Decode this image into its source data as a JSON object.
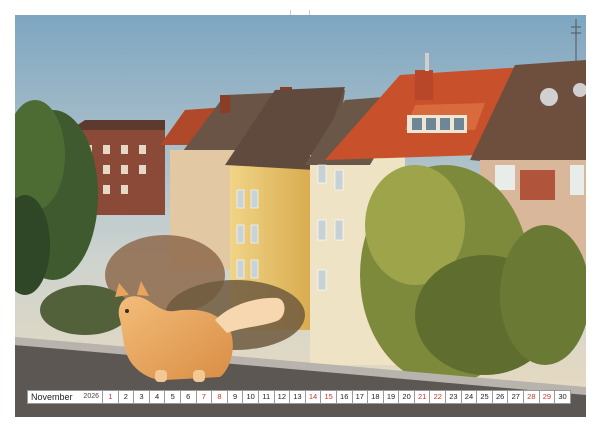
{
  "calendar": {
    "month": "November",
    "year": "2026",
    "days": [
      {
        "n": "1",
        "we": true
      },
      {
        "n": "2",
        "we": false
      },
      {
        "n": "3",
        "we": false
      },
      {
        "n": "4",
        "we": false
      },
      {
        "n": "5",
        "we": false
      },
      {
        "n": "6",
        "we": false
      },
      {
        "n": "7",
        "we": true
      },
      {
        "n": "8",
        "we": true
      },
      {
        "n": "9",
        "we": false
      },
      {
        "n": "10",
        "we": false
      },
      {
        "n": "11",
        "we": false
      },
      {
        "n": "12",
        "we": false
      },
      {
        "n": "13",
        "we": false
      },
      {
        "n": "14",
        "we": true
      },
      {
        "n": "15",
        "we": true
      },
      {
        "n": "16",
        "we": false
      },
      {
        "n": "17",
        "we": false
      },
      {
        "n": "18",
        "we": false
      },
      {
        "n": "19",
        "we": false
      },
      {
        "n": "20",
        "we": false
      },
      {
        "n": "21",
        "we": true
      },
      {
        "n": "22",
        "we": true
      },
      {
        "n": "23",
        "we": false
      },
      {
        "n": "24",
        "we": false
      },
      {
        "n": "25",
        "we": false
      },
      {
        "n": "26",
        "we": false
      },
      {
        "n": "27",
        "we": false
      },
      {
        "n": "28",
        "we": true
      },
      {
        "n": "29",
        "we": true
      },
      {
        "n": "30",
        "we": false
      }
    ]
  },
  "colors": {
    "sky_top": "#8fb2c9",
    "sky_bottom": "#e9dcc2",
    "roof_red": "#c8502b",
    "roof_brown": "#6e4f3d",
    "wall_yellow": "#e9c86a",
    "cat": "#e8a45c",
    "weekend": "#c0392b"
  }
}
